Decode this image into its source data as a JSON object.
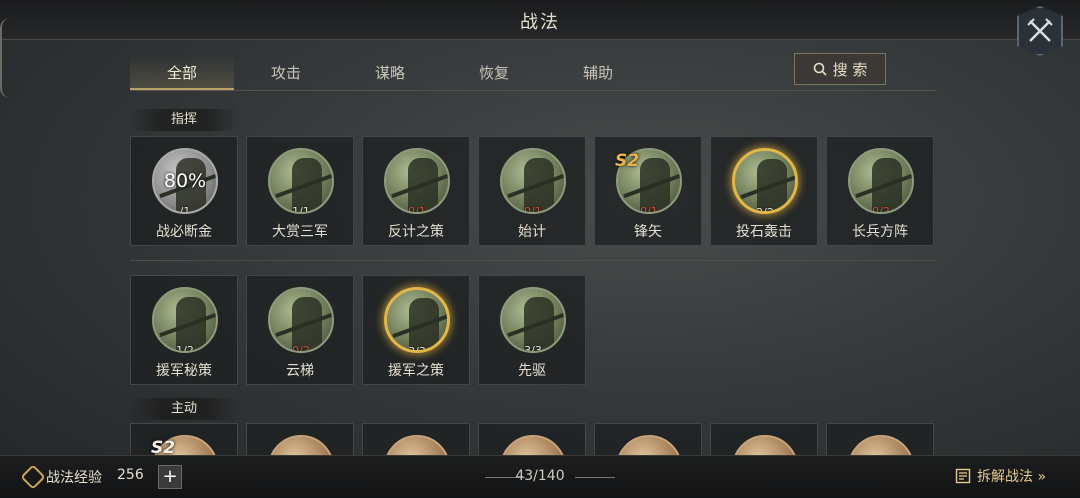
{
  "window": {
    "title": "战法"
  },
  "tabs": [
    {
      "label": "全部",
      "active": true
    },
    {
      "label": "攻击"
    },
    {
      "label": "谋略"
    },
    {
      "label": "恢复"
    },
    {
      "label": "辅助"
    }
  ],
  "search": {
    "label": "搜 索",
    "icon": "search-icon"
  },
  "sections": {
    "command": "指挥",
    "active": "主动"
  },
  "command_skills": [
    {
      "name": "战必断金",
      "count": "/1",
      "progress_text": "80%",
      "style": "gray"
    },
    {
      "name": "大赏三军",
      "count": "1/1"
    },
    {
      "name": "反计之策",
      "count": "0/1",
      "count_red": true
    },
    {
      "name": "始计",
      "count": "0/1",
      "count_red": true
    },
    {
      "name": "锋矢",
      "count": "0/1",
      "count_red": true,
      "badge": "S2"
    },
    {
      "name": "投石轰击",
      "count": "2/2",
      "highlight": "gold"
    },
    {
      "name": "长兵方阵",
      "count": "0/2",
      "count_red": true
    },
    {
      "name": "援军秘策",
      "count": "1/2"
    },
    {
      "name": "云梯",
      "count": "0/2",
      "count_red": true
    },
    {
      "name": "援军之策",
      "count": "3/3",
      "highlight": "gold"
    },
    {
      "name": "先驱",
      "count": "3/3"
    }
  ],
  "active_skills_partial": [
    {
      "badge": "S2"
    },
    {},
    {},
    {},
    {},
    {},
    {}
  ],
  "footer": {
    "exp_label": "战法经验",
    "exp_value": "256",
    "plus": "+",
    "page": "43/140",
    "dismantle": "拆解战法 »"
  },
  "colors": {
    "accent_gold": "#e2b648",
    "count_red": "#d8503f",
    "tab_underline": "#b9a16a"
  }
}
